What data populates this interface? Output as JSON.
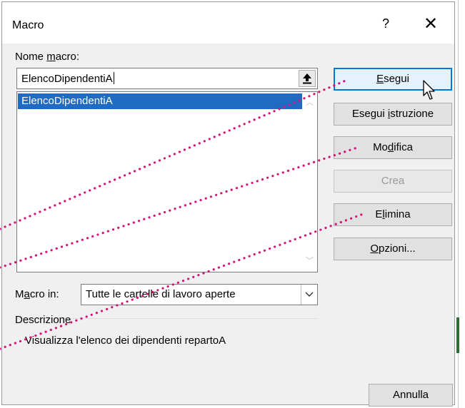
{
  "dialog": {
    "title": "Macro",
    "help_glyph": "?",
    "close_glyph": "✕"
  },
  "name_label": {
    "pre": "Nome ",
    "key": "m",
    "post": "acro:"
  },
  "name_input": {
    "value": "ElencoDipendentiA"
  },
  "macro_list": [
    "ElencoDipendentiA"
  ],
  "buttons": {
    "esegui": {
      "pre": "",
      "key": "E",
      "post": "segui"
    },
    "esegui_istruzione": {
      "pre": "Esegui ",
      "key": "i",
      "post": "struzione"
    },
    "modifica": {
      "pre": "Mo",
      "key": "d",
      "post": "ifica"
    },
    "crea": {
      "label": "Crea"
    },
    "elimina": {
      "pre": "E",
      "key": "l",
      "post": "imina"
    },
    "opzioni": {
      "pre": "",
      "key": "O",
      "post": "pzioni..."
    },
    "annulla": {
      "label": "Annulla"
    }
  },
  "macro_in": {
    "label_pre": "M",
    "label_key": "a",
    "label_post": "cro in:",
    "value": "Tutte le cartelle di lavoro aperte"
  },
  "description": {
    "label": "Descrizione",
    "text": "Visualizza l'elenco dei dipendenti repartoA"
  },
  "colors": {
    "selection": "#1f6bc4",
    "default_border": "#0078d7",
    "annotation_dots": "#d4147c"
  }
}
